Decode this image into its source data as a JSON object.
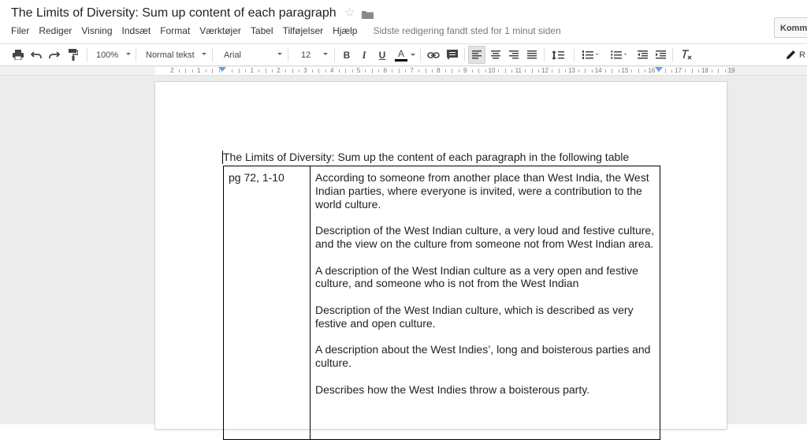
{
  "header": {
    "title": "The Limits of Diversity: Sum up content of each paragraph",
    "menu": [
      "Filer",
      "Rediger",
      "Visning",
      "Indsæt",
      "Format",
      "Værktøjer",
      "Tabel",
      "Tilføjelser",
      "Hjælp"
    ],
    "last_edit": "Sidste redigering fandt sted for 1 minut siden",
    "comment_button": "Kommentarer"
  },
  "toolbar": {
    "zoom": "100%",
    "style": "Normal tekst",
    "font": "Arial",
    "size": "12",
    "bold": "B",
    "italic": "I",
    "underline": "U",
    "text_color": "A",
    "right_edge": "R"
  },
  "ruler": {
    "left_labels": [
      "2",
      "1"
    ],
    "right_labels": [
      "1",
      "2",
      "3",
      "4",
      "5",
      "6",
      "7",
      "8",
      "9",
      "10",
      "11",
      "12",
      "13",
      "14",
      "15",
      "16",
      "17",
      "18",
      "19"
    ]
  },
  "document": {
    "heading": "The Limits of Diversity: Sum up the content of each paragraph in the following table",
    "table": {
      "cell_label": "pg 72, 1-10",
      "paragraphs": [
        "According to someone from another place than West India, the West Indian parties, where everyone is invited, were a contribution to the world culture.",
        "Description of the West Indian culture, a very loud and festive culture, and the view on the culture from someone not from West Indian area.",
        "A description of the West Indian culture as a very open and festive culture, and someone who is not from the West Indian",
        "Description of the West Indian culture, which is described as very festive and open culture.",
        "A description about the West Indies’, long and boisterous parties and culture.",
        "Describes how the West Indies throw a boisterous party."
      ]
    }
  },
  "colors": {
    "workspace": "#ececec",
    "indent_marker": "#6a9be8",
    "text_color_bar": "#000000"
  }
}
